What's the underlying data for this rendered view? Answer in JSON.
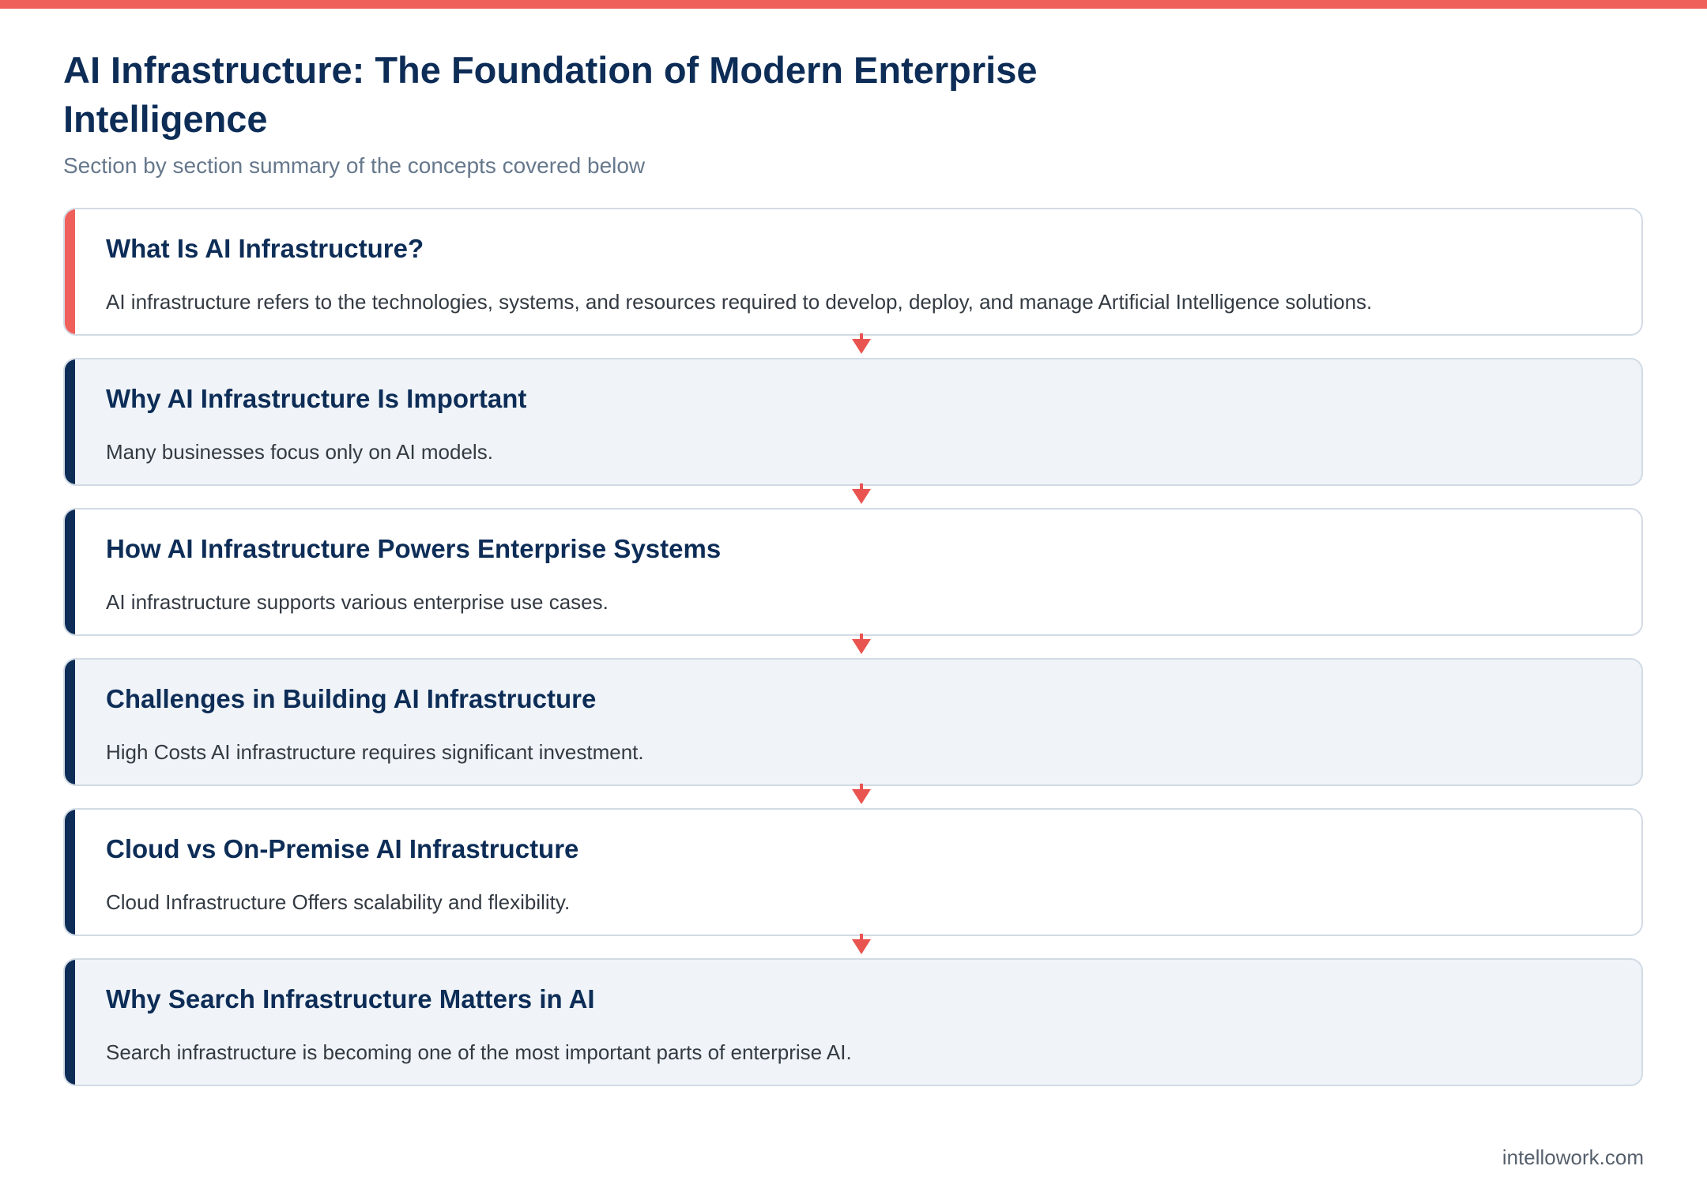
{
  "theme": {
    "accent": "#f0605a",
    "navy": "#0d2d57",
    "card_alt_background": "#f0f4f8",
    "border": "#d2dbe5"
  },
  "header": {
    "title": "AI Infrastructure: The Foundation of Modern Enterprise Intelligence",
    "subtitle": "Section by section summary of the concepts covered below"
  },
  "steps": [
    {
      "title": "What Is AI Infrastructure?",
      "description": "AI infrastructure refers to the technologies, systems, and resources required to develop, deploy, and manage Artificial Intelligence solutions."
    },
    {
      "title": "Why AI Infrastructure Is Important",
      "description": "Many businesses focus only on AI models."
    },
    {
      "title": "How AI Infrastructure Powers Enterprise Systems",
      "description": "AI infrastructure supports various enterprise use cases."
    },
    {
      "title": "Challenges in Building AI Infrastructure",
      "description": "High Costs AI infrastructure requires significant investment."
    },
    {
      "title": "Cloud vs On-Premise AI Infrastructure",
      "description": "Cloud Infrastructure Offers scalability and flexibility."
    },
    {
      "title": "Why Search Infrastructure Matters in AI",
      "description": "Search infrastructure is becoming one of the most important parts of enterprise AI."
    }
  ],
  "footer": {
    "site": "intellowork.com"
  }
}
